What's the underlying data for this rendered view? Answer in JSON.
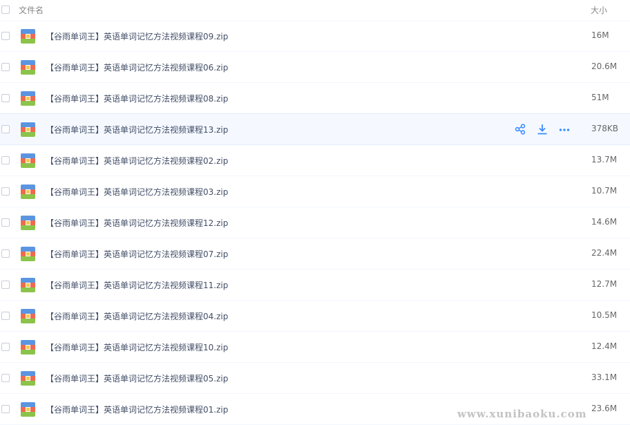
{
  "header": {
    "name_label": "文件名",
    "size_label": "大小"
  },
  "files": [
    {
      "name": "【谷雨单词王】英语单词记忆方法视频课程09.zip",
      "size": "16M"
    },
    {
      "name": "【谷雨单词王】英语单词记忆方法视频课程06.zip",
      "size": "20.6M"
    },
    {
      "name": "【谷雨单词王】英语单词记忆方法视频课程08.zip",
      "size": "51M"
    },
    {
      "name": "【谷雨单词王】英语单词记忆方法视频课程13.zip",
      "size": "378KB"
    },
    {
      "name": "【谷雨单词王】英语单词记忆方法视频课程02.zip",
      "size": "13.7M"
    },
    {
      "name": "【谷雨单词王】英语单词记忆方法视频课程03.zip",
      "size": "10.7M"
    },
    {
      "name": "【谷雨单词王】英语单词记忆方法视频课程12.zip",
      "size": "14.6M"
    },
    {
      "name": "【谷雨单词王】英语单词记忆方法视频课程07.zip",
      "size": "22.4M"
    },
    {
      "name": "【谷雨单词王】英语单词记忆方法视频课程11.zip",
      "size": "12.7M"
    },
    {
      "name": "【谷雨单词王】英语单词记忆方法视频课程04.zip",
      "size": "10.5M"
    },
    {
      "name": "【谷雨单词王】英语单词记忆方法视频课程10.zip",
      "size": "12.4M"
    },
    {
      "name": "【谷雨单词王】英语单词记忆方法视频课程05.zip",
      "size": "33.1M"
    },
    {
      "name": "【谷雨单词王】英语单词记忆方法视频课程01.zip",
      "size": "23.6M"
    }
  ],
  "hovered_row": 3,
  "row_actions": [
    "share-icon",
    "download-icon",
    "more-icon"
  ],
  "colors": {
    "accent": "#3b8cff",
    "hover_bg": "#f5f9ff"
  },
  "watermark": "www.xunibaoku.com"
}
